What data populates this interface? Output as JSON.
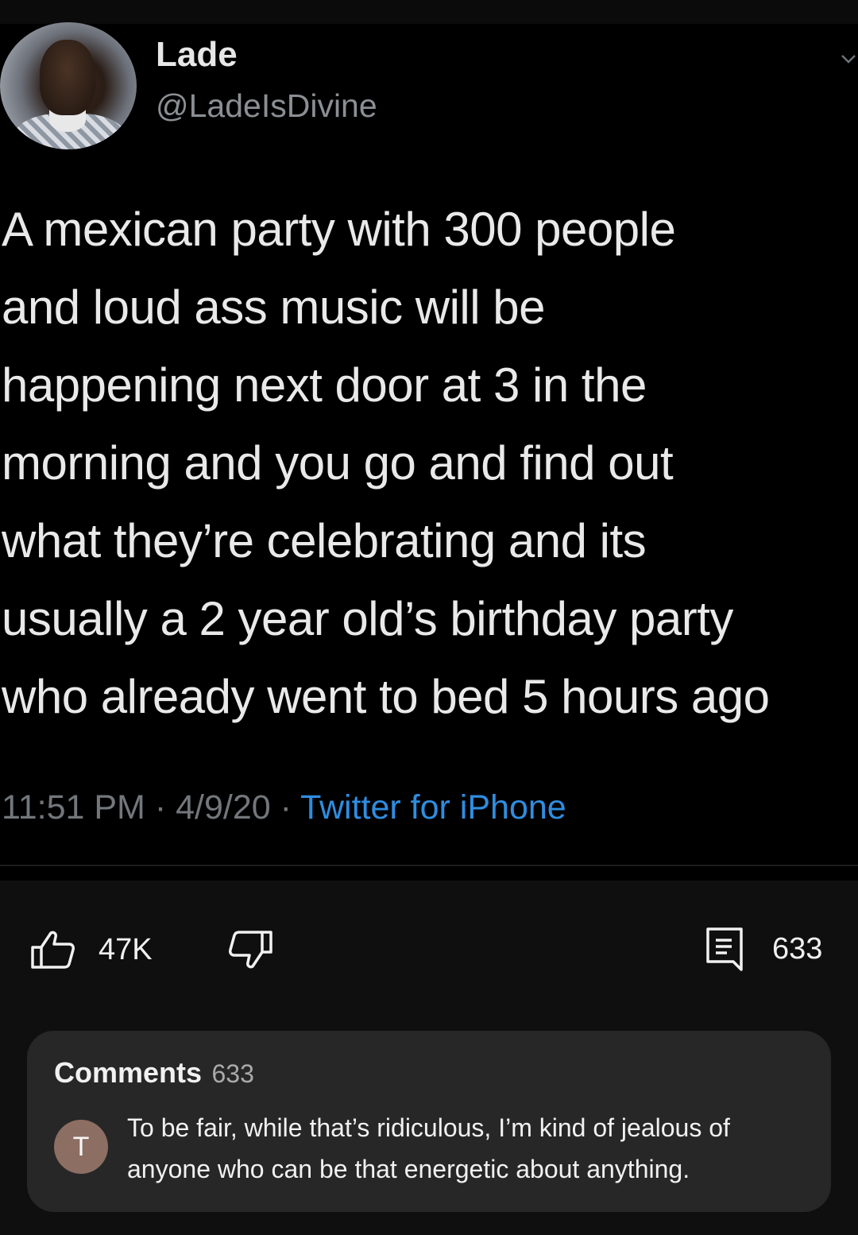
{
  "tweet": {
    "display_name": "Lade",
    "handle": "@LadeIsDivine",
    "text": "A mexican party with 300 people\nand loud ass music will be\nhappening next door at 3 in the\nmorning and you go and find out\nwhat they’re celebrating and its\nusually a 2 year old’s birthday party\nwho already went to bed 5 hours ago",
    "time": "11:51 PM",
    "separator": " · ",
    "date": "4/9/20",
    "source": "Twitter for iPhone"
  },
  "actions": {
    "like_count": "47K",
    "comment_count": "633",
    "icons": [
      "thumbs-up-icon",
      "thumbs-down-icon",
      "comments-icon"
    ]
  },
  "comments": {
    "title": "Comments",
    "count": "633",
    "top_comment": {
      "avatar_letter": "T",
      "text": "To be fair, while that’s ridiculous, I’m kind of jealous of anyone who can be that energetic about anything."
    }
  },
  "colors": {
    "background": "#0f0f0f",
    "card": "#272727",
    "link": "#2f8de0",
    "avatar_bg": "#8d6e63"
  }
}
